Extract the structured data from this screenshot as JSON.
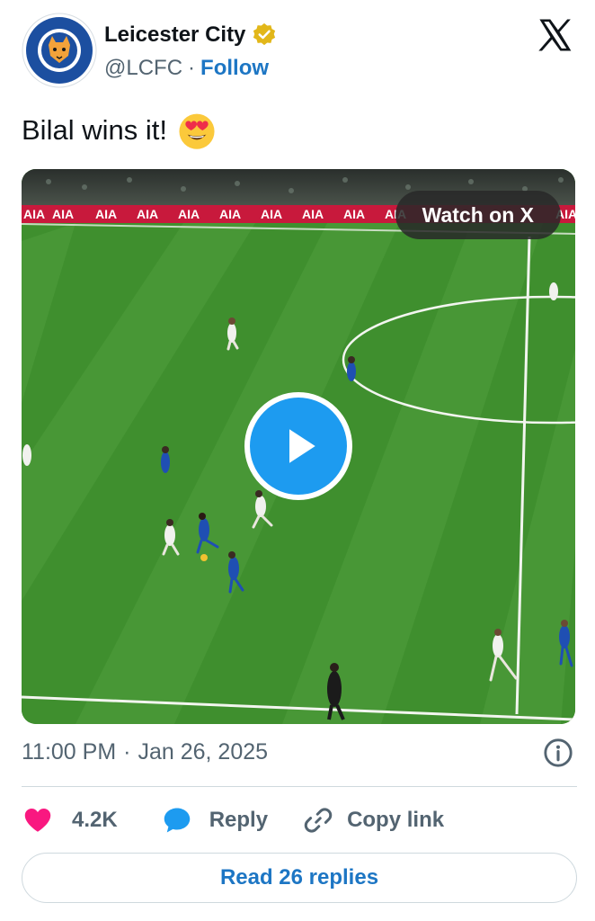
{
  "author": {
    "name": "Leicester City",
    "handle": "@LCFC",
    "separator": "·",
    "follow_label": "Follow",
    "avatar_icon": "leicester-city-crest-icon",
    "verified_icon": "verified-gold-badge-icon"
  },
  "brand_icon": "x-logo-icon",
  "tweet": {
    "text": "Bilal wins it!",
    "emoji_icon": "heart-eyes-emoji-icon"
  },
  "media": {
    "watch_label": "Watch on X",
    "play_icon": "play-icon",
    "board_text": "AIA"
  },
  "meta": {
    "time": "11:00 PM",
    "separator": "·",
    "date": "Jan 26, 2025",
    "info_icon": "info-icon"
  },
  "actions": {
    "like_count": "4.2K",
    "reply_label": "Reply",
    "copy_label": "Copy link"
  },
  "read_replies_label": "Read 26 replies",
  "colors": {
    "link": "#1d76c4",
    "like": "#f91880",
    "play": "#1d9bf0",
    "muted": "#536471"
  }
}
